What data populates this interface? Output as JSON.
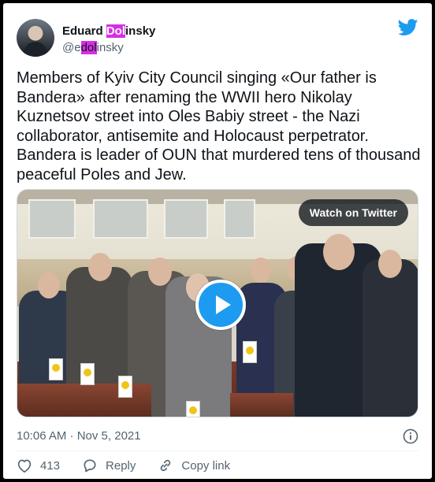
{
  "author": {
    "name_pre": "Eduard ",
    "name_hl": "Dol",
    "name_post": "insky",
    "handle_pre": "@e",
    "handle_hl": "dol",
    "handle_post": "insky"
  },
  "tweet": {
    "text": "Members of Kyiv City Council singing «Our father is Bandera» after renaming the WWII hero Nikolay Kuznetsov street into Oles Babiy street - the Nazi collaborator, antisemite and Holocaust perpetrator. Bandera is leader of OUN that murdered tens of thousand peaceful Poles and Jew.",
    "timestamp": "10:06 AM · Nov 5, 2021"
  },
  "media": {
    "watch_label": "Watch on Twitter"
  },
  "actions": {
    "likes": "413",
    "reply_label": "Reply",
    "copy_link_label": "Copy link"
  },
  "icons": {
    "brand": "twitter-bird-icon",
    "like": "heart-icon",
    "reply": "reply-icon",
    "copy": "link-icon",
    "info": "info-icon",
    "play": "play-icon"
  },
  "colors": {
    "brand": "#1d9bf0",
    "highlight": "#d62ee6",
    "secondary_text": "#536471"
  }
}
